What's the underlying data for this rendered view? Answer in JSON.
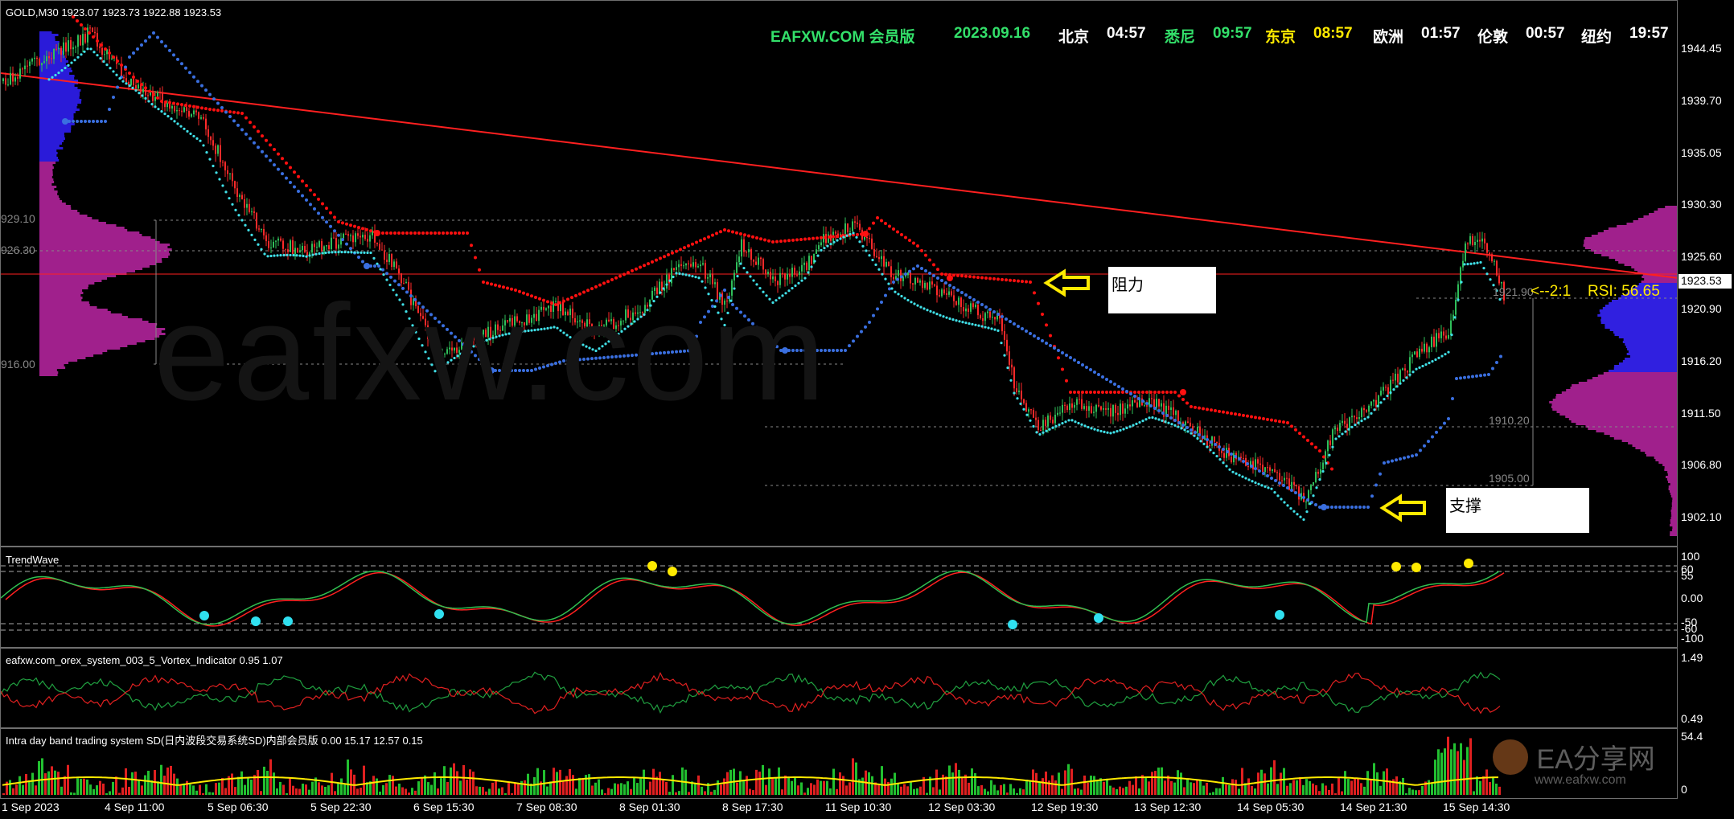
{
  "header": {
    "symbol_info": "GOLD,M30  1923.07 1923.73 1922.88 1923.53"
  },
  "clock": {
    "site": "EAFXW.COM 会员版",
    "date": "2023.09.16",
    "cities": [
      {
        "name": "北京",
        "time": "04:57",
        "color": "#ffffff"
      },
      {
        "name": "悉尼",
        "time": "09:57",
        "color": "#33e06a"
      },
      {
        "name": "东京",
        "time": "08:57",
        "color": "#ffea00"
      },
      {
        "name": "欧洲",
        "time": "01:57",
        "color": "#ffffff"
      },
      {
        "name": "伦敦",
        "time": "00:57",
        "color": "#ffffff"
      },
      {
        "name": "纽约",
        "time": "19:57",
        "color": "#ffffff"
      }
    ]
  },
  "watermark": "eafxw.com",
  "price_axis": [
    "1944.45",
    "1939.70",
    "1935.05",
    "1930.30",
    "1925.60",
    "1920.90",
    "1916.20",
    "1911.50",
    "1906.80",
    "1902.10"
  ],
  "current_price": "1923.53",
  "levels": {
    "left": [
      "929.10",
      "926.30",
      "916.00"
    ],
    "right": [
      "1921.90",
      "1910.20",
      "1905.00"
    ]
  },
  "ratio_text": "<--2:1",
  "rsi_text": "RSI: 56.65",
  "annotations": {
    "resistance": "阻力",
    "support": "支撑"
  },
  "indicators": {
    "trendwave": {
      "title": "TrendWave",
      "axis": [
        "100",
        "60",
        "55",
        "0.00",
        "-50",
        "-60",
        "-100"
      ]
    },
    "vortex": {
      "title": "eafxw.com_orex_system_003_5_Vortex_Indicator 0.95 1.07",
      "axis": [
        "1.49",
        "0.49"
      ]
    },
    "band": {
      "title": "Intra day band trading system SD(日内波段交易系统SD)内部会员版 0.00 15.17 12.57 0.15",
      "axis": [
        "54.4",
        "0"
      ]
    }
  },
  "time_axis": [
    "1 Sep 2023",
    "4 Sep 11:00",
    "5 Sep 06:30",
    "5 Sep 22:30",
    "6 Sep 15:30",
    "7 Sep 08:30",
    "8 Sep 01:30",
    "8 Sep 17:30",
    "11 Sep 10:30",
    "12 Sep 03:30",
    "12 Sep 19:30",
    "13 Sep 12:30",
    "14 Sep 05:30",
    "14 Sep 21:30",
    "15 Sep 14:30"
  ],
  "logo": {
    "name": "EA分享网",
    "url": "www.eafxw.com"
  },
  "colors": {
    "bull": "#2fbf5a",
    "bear": "#ff2a2a",
    "resist": "#ff1010",
    "support": "#3a6fe0",
    "cyan": "#40e0e8",
    "yellow": "#ffea00"
  }
}
